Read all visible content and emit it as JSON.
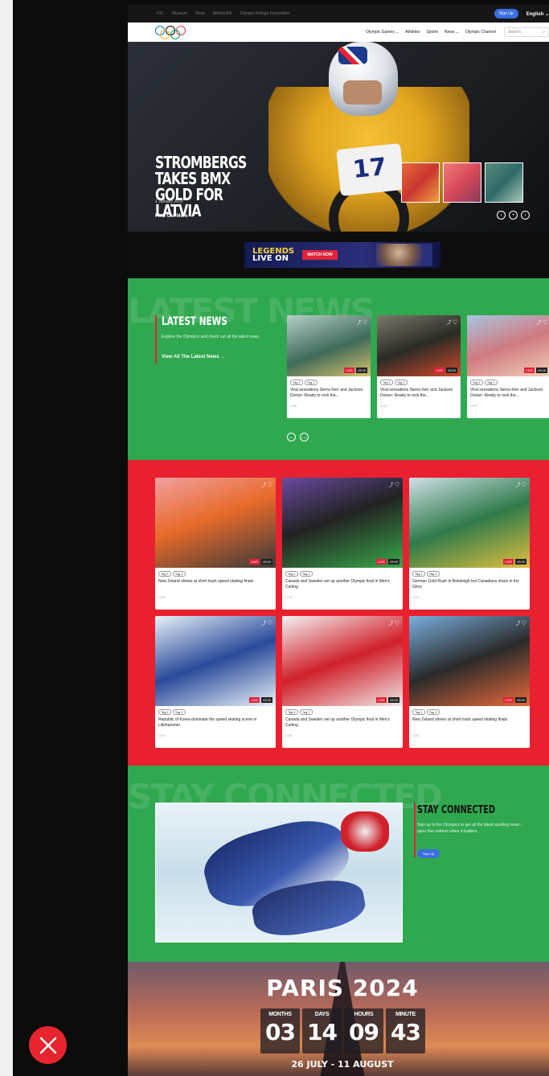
{
  "utility": {
    "links": [
      "IOC",
      "Museum",
      "Shop",
      "Athlete365",
      "Olympic Refuge Foundation"
    ],
    "signup": "Sign Up",
    "language": "English"
  },
  "nav": {
    "items": [
      "Olympic Games ⌄",
      "Athletes",
      "Sports",
      "News ⌄",
      "Olympic Channel"
    ],
    "search_placeholder": "Search"
  },
  "hero": {
    "title": "STROMBERGS TAKES BMX GOLD FOR LATVIA",
    "date": "1 January 2020",
    "cta": "Find Out More →",
    "bike_number": "17"
  },
  "banner": {
    "title_line1": "LEGENDS",
    "title_line2": "LIVE ON",
    "button": "WATCH NOW"
  },
  "latest": {
    "ghost": "LATEST NEWS",
    "title": "LATEST NEWS",
    "description": "Explore the Olympics and check out all the latest news.",
    "link": "View All The Latest News →",
    "cards": [
      {
        "tag1": "Tag 1",
        "tag2": "Tag 2",
        "live": "LIVE",
        "time": "43:00",
        "text": "Viral sensations Sierra Kerr and Jackson Dorian: Ready to rock the...",
        "meta": "LIVE"
      },
      {
        "tag1": "Tag 1",
        "tag2": "Tag 2",
        "live": "LIVE",
        "time": "43:00",
        "text": "Viral sensations Sierra Kerr and Jackson Dorian: Ready to rock the...",
        "meta": "LIVE"
      },
      {
        "tag1": "Tag 1",
        "tag2": "Tag 2",
        "live": "LIVE",
        "time": "43:00",
        "text": "Viral sensations Sierra Kerr and Jackson Dorian: Ready to rock the...",
        "meta": "LIVE"
      }
    ]
  },
  "grid": {
    "cards": [
      {
        "tag1": "Tag 1",
        "tag2": "Tag 2",
        "live": "LIVE",
        "time": "43:00",
        "text": "New Zeland shines at short track speed skating finals",
        "meta": "LIVE"
      },
      {
        "tag1": "Tag 1",
        "tag2": "Tag 2",
        "live": "LIVE",
        "time": "43:00",
        "text": "Canada and Sweden set up another Olympic final in Men's Curling",
        "meta": "LIVE"
      },
      {
        "tag1": "Tag 1",
        "tag2": "Tag 2",
        "live": "LIVE",
        "time": "43:00",
        "text": "German Gold Rush in Bobsleigh but Canadians share in the Glory",
        "meta": "LIVE"
      },
      {
        "tag1": "Tag 1",
        "tag2": "Tag 2",
        "live": "LIVE",
        "time": "43:00",
        "text": "Republic of Korea dominate the speed skating scene in Lillehammer",
        "meta": "LIVE"
      },
      {
        "tag1": "Tag 1",
        "tag2": "Tag 2",
        "live": "LIVE",
        "time": "43:00",
        "text": "Canada and Sweden set up another Olympic final in Men's Curling",
        "meta": "LIVE"
      },
      {
        "tag1": "Tag 1",
        "tag2": "Tag 2",
        "live": "LIVE",
        "time": "43:00",
        "text": "New Zeland shines at short track speed skating finals",
        "meta": "LIVE"
      }
    ]
  },
  "stay": {
    "ghost": "STAY CONNECTED",
    "title": "STAY CONNECTED",
    "description": "Sign up to the Olympics to get all the latest sporting news - sport that matters when it matters.",
    "button": "Sign Up"
  },
  "paris": {
    "title": "PARIS 2024",
    "countdown": [
      {
        "label": "MONTHS",
        "value": "03"
      },
      {
        "label": "DAYS",
        "value": "14"
      },
      {
        "label": "HOURS",
        "value": "09"
      },
      {
        "label": "MINUTE",
        "value": "43"
      }
    ],
    "dates": "26 JULY - 11 AUGUST"
  },
  "colors": {
    "green": "#2fa84f",
    "red": "#e8202f",
    "blue": "#3a6fe0"
  }
}
